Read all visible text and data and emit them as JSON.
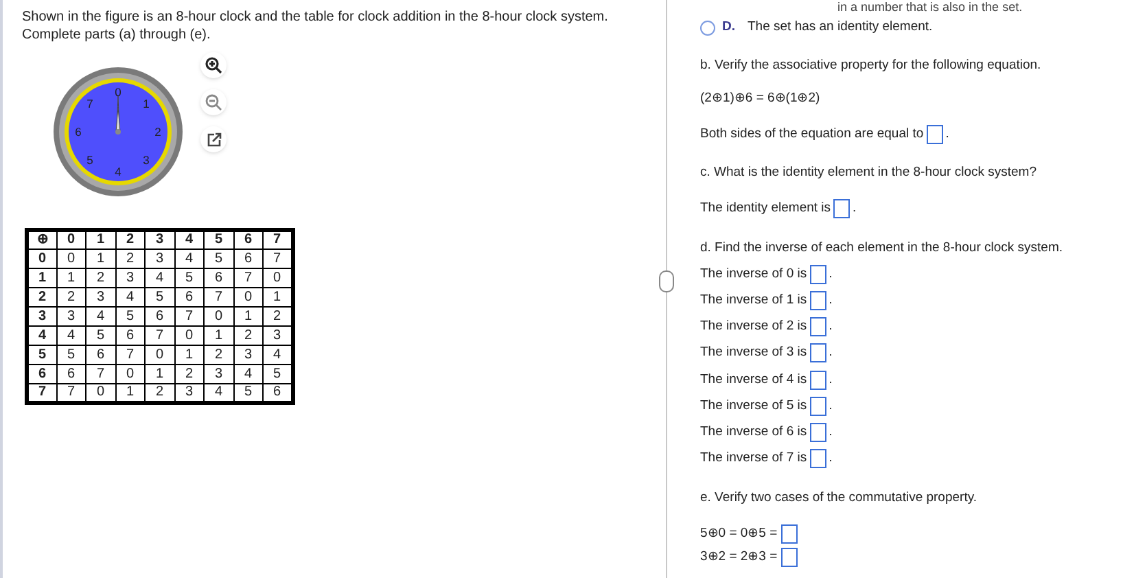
{
  "question": {
    "lines": [
      "Shown in the figure is an 8-hour clock and the table for clock addition in the 8-hour clock system.",
      "Complete parts (a) through (e)."
    ]
  },
  "clock": {
    "numbers": [
      "0",
      "1",
      "2",
      "3",
      "4",
      "5",
      "6",
      "7"
    ]
  },
  "table": {
    "corner": "⊕",
    "columns": [
      "0",
      "1",
      "2",
      "3",
      "4",
      "5",
      "6",
      "7"
    ],
    "rows": [
      {
        "header": "0",
        "cells": [
          "0",
          "1",
          "2",
          "3",
          "4",
          "5",
          "6",
          "7"
        ]
      },
      {
        "header": "1",
        "cells": [
          "1",
          "2",
          "3",
          "4",
          "5",
          "6",
          "7",
          "0"
        ]
      },
      {
        "header": "2",
        "cells": [
          "2",
          "3",
          "4",
          "5",
          "6",
          "7",
          "0",
          "1"
        ]
      },
      {
        "header": "3",
        "cells": [
          "3",
          "4",
          "5",
          "6",
          "7",
          "0",
          "1",
          "2"
        ]
      },
      {
        "header": "4",
        "cells": [
          "4",
          "5",
          "6",
          "7",
          "0",
          "1",
          "2",
          "3"
        ]
      },
      {
        "header": "5",
        "cells": [
          "5",
          "6",
          "7",
          "0",
          "1",
          "2",
          "3",
          "4"
        ]
      },
      {
        "header": "6",
        "cells": [
          "6",
          "7",
          "0",
          "1",
          "2",
          "3",
          "4",
          "5"
        ]
      },
      {
        "header": "7",
        "cells": [
          "7",
          "0",
          "1",
          "2",
          "3",
          "4",
          "5",
          "6"
        ]
      }
    ]
  },
  "answers": [
    {
      "kind": "cut",
      "text": "in a number that is also in the set."
    },
    {
      "kind": "option",
      "letter": "D.",
      "text": "The set has an identity element.",
      "selected": false
    },
    {
      "kind": "heading",
      "text": "b. Verify the associative property for the following equation."
    },
    {
      "kind": "equation",
      "text": "(2⊕1)⊕6 = 6⊕(1⊕2)"
    },
    {
      "kind": "fill",
      "text": "Both sides of the equation are equal to",
      "after": "."
    },
    {
      "kind": "heading",
      "text": "c. What is the identity element in the 8-hour clock system?"
    },
    {
      "kind": "fill",
      "text": "The identity element is",
      "after": "."
    },
    {
      "kind": "heading",
      "text": "d. Find the inverse of each element in the 8-hour clock system."
    },
    {
      "kind": "fillrow",
      "text": "The inverse of 0 is",
      "after": "."
    },
    {
      "kind": "fillrow",
      "text": "The inverse of 1 is",
      "after": "."
    },
    {
      "kind": "fillrow",
      "text": "The inverse of 2 is",
      "after": "."
    },
    {
      "kind": "fillrow",
      "text": "The inverse of 3 is",
      "after": "."
    },
    {
      "kind": "fillrow",
      "text": "The inverse of 4 is",
      "after": "."
    },
    {
      "kind": "fillrow",
      "text": "The inverse of 5 is",
      "after": "."
    },
    {
      "kind": "fillrow",
      "text": "The inverse of 6 is",
      "after": "."
    },
    {
      "kind": "fillrow",
      "text": "The inverse of 7 is",
      "after": "."
    },
    {
      "kind": "heading",
      "text": "e. Verify two cases of the commutative property."
    },
    {
      "kind": "eqrow",
      "text": "5⊕0 = 0⊕5 ="
    },
    {
      "kind": "eqrow",
      "text": "3⊕2 = 2⊕3 ="
    }
  ]
}
